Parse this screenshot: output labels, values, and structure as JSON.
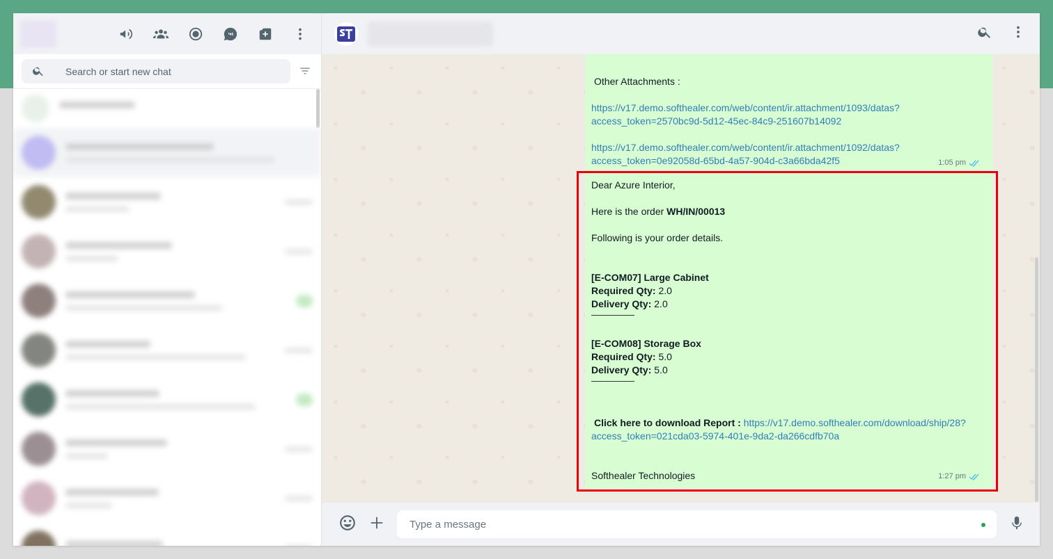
{
  "sidebar": {
    "search": {
      "placeholder": "Search or start new chat"
    },
    "header_icons": [
      "megaphone-icon",
      "community-icon",
      "status-icon",
      "channels-icon",
      "new-chat-icon",
      "menu-icon"
    ]
  },
  "chat": {
    "composer": {
      "placeholder": "Type a message"
    },
    "message1": {
      "heading": "Other Attachments :",
      "link1_line1": "https://v17.demo.softhealer.com/web/content/ir.attachment/1093/datas?",
      "link1_line2": "access_token=2570bc9d-5d12-45ec-84c9-251607b14092",
      "link2_line1": "https://v17.demo.softhealer.com/web/content/ir.attachment/1092/datas?",
      "link2_line2": "access_token=0e92058d-65bd-4a57-904d-c3a66bda42f5",
      "time": "1:05 pm"
    },
    "message2": {
      "greeting": "Dear Azure Interior,",
      "order_prefix": "Here is the order ",
      "order_ref": "WH/IN/00013",
      "details_intro": "Following is your order details.",
      "items": [
        {
          "name": "[E-COM07] Large Cabinet",
          "req_label": "Required Qty:",
          "req": " 2.0",
          "del_label": "Delivery Qty:",
          "del": " 2.0"
        },
        {
          "name": "[E-COM08] Storage Box",
          "req_label": "Required Qty:",
          "req": " 5.0",
          "del_label": "Delivery Qty:",
          "del": " 5.0"
        }
      ],
      "report_label": "Click here to download Report :",
      "report_link_line1": "https://v17.demo.softhealer.com/download/ship/28?",
      "report_link_line2": "access_token=021cda03-5974-401e-9da2-da266cdfb70a",
      "signature": "Softhealer Technologies",
      "time": "1:27 pm"
    }
  },
  "colors": {
    "accent": "#5aa785",
    "bubble": "#d9fdd3",
    "highlight": "#e8000b",
    "link": "#2f7fb6"
  }
}
